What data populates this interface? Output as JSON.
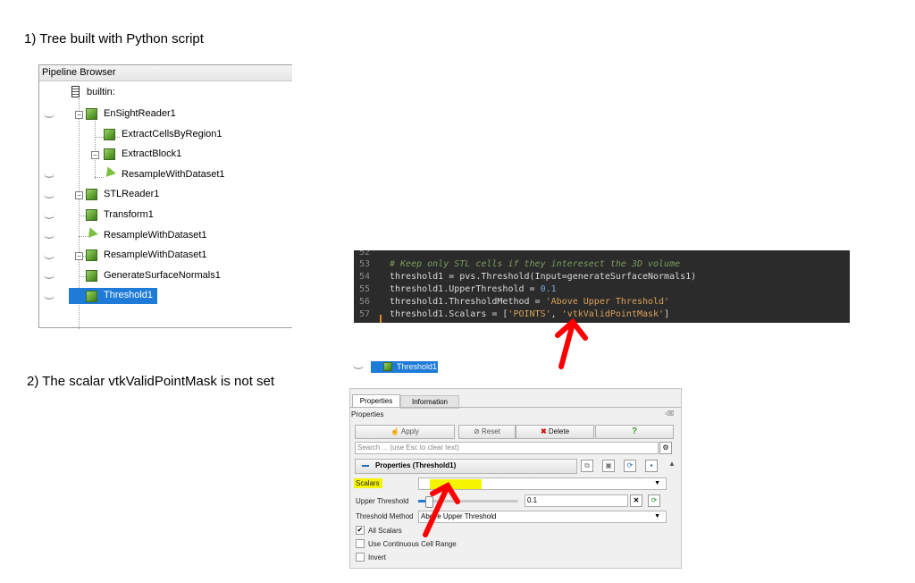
{
  "captions": {
    "c1": "1) Tree built with Python script",
    "c2": "2)  The scalar vtkValidPointMask  is not set"
  },
  "pipeline": {
    "header": "Pipeline Browser",
    "items": [
      {
        "label": "builtin:",
        "icon": "server-icon"
      },
      {
        "label": "EnSightReader1",
        "icon": "cube-icon"
      },
      {
        "label": "ExtractCellsByRegion1",
        "icon": "cube-icon"
      },
      {
        "label": "ExtractBlock1",
        "icon": "cube-icon"
      },
      {
        "label": "ResampleWithDataset1",
        "icon": "arrow-icon"
      },
      {
        "label": "STLReader1",
        "icon": "cube-icon"
      },
      {
        "label": "Transform1",
        "icon": "cube-icon"
      },
      {
        "label": "ResampleWithDataset1",
        "icon": "arrow-icon"
      },
      {
        "label": "ResampleWithDataset1",
        "icon": "cube-icon"
      },
      {
        "label": "GenerateSurfaceNormals1",
        "icon": "cube-icon"
      },
      {
        "label": "Threshold1",
        "icon": "cube-icon"
      }
    ]
  },
  "code": {
    "lines": [
      {
        "n": "52",
        "text": ""
      },
      {
        "n": "53",
        "text": "# Keep only STL cells if they interesect the 3D volume"
      },
      {
        "n": "54",
        "text": "threshold1 = pvs.Threshold(Input=generateSurfaceNormals1)"
      },
      {
        "n": "55",
        "text": "threshold1.UpperThreshold = 0.1"
      },
      {
        "n": "56",
        "text": "threshold1.ThresholdMethod = 'Above Upper Threshold'"
      },
      {
        "n": "57",
        "text": "threshold1.Scalars = ['POINTS', 'vtkValidPointMask']"
      }
    ]
  },
  "mini_tree": {
    "label": "Threshold1"
  },
  "props": {
    "tabs": [
      "Properties",
      "Information"
    ],
    "section_title": "Properties",
    "apply": "Apply",
    "reset": "Reset",
    "delete": "Delete",
    "help": "?",
    "search_placeholder": "Search ... (use Esc to clear text)",
    "group_title": "Properties (Threshold1)",
    "scalars_label": "Scalars",
    "scalars_value": "",
    "upper_threshold_label": "Upper Threshold",
    "upper_threshold_value": "0.1",
    "threshold_method_label": "Threshold Method",
    "threshold_method_value": "Above Upper Threshold",
    "all_scalars": "All Scalars",
    "continuous": "Use Continuous Cell Range",
    "invert": "Invert"
  },
  "colors": {
    "highlight": "#f5f500",
    "annotation_arrow": "#ff0000",
    "selection": "#1e7bd7"
  }
}
